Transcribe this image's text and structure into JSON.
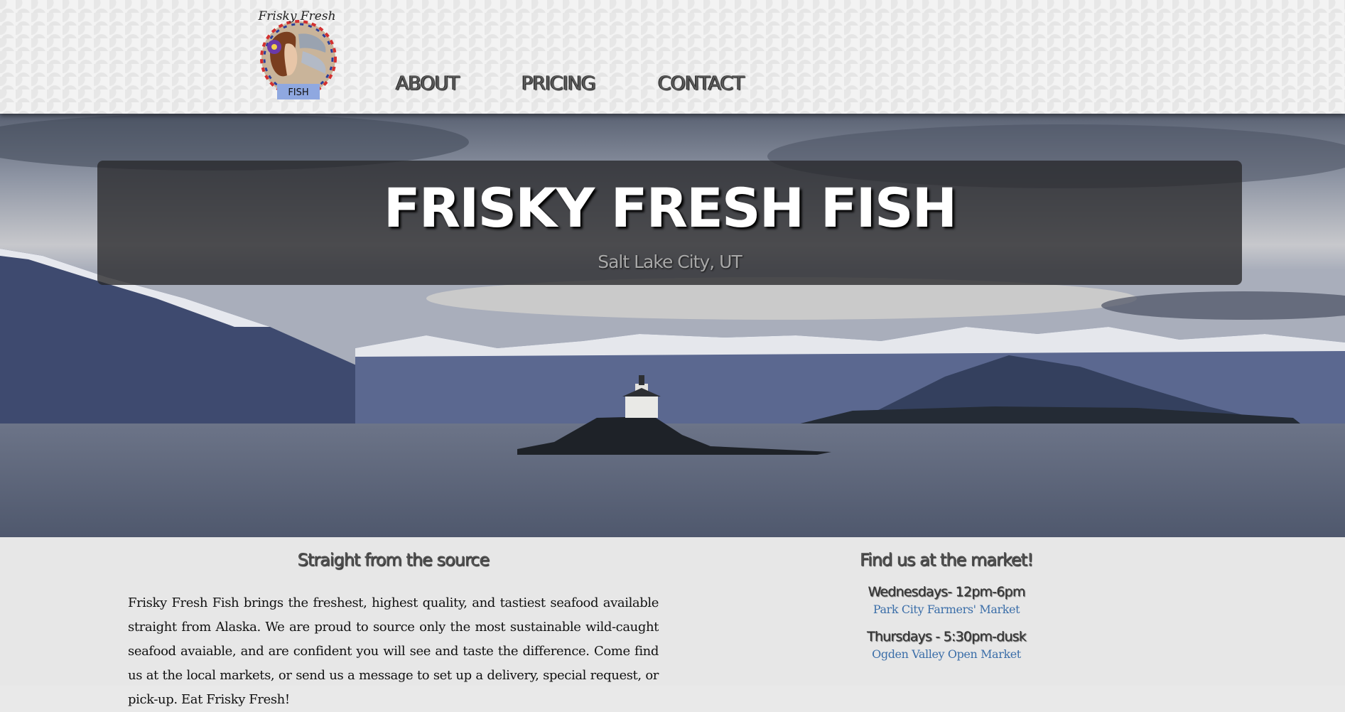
{
  "header": {
    "logo": {
      "text_top": "Frisky Fresh",
      "text_bottom": "FISH"
    },
    "nav": [
      {
        "label": "ABOUT"
      },
      {
        "label": "PRICING"
      },
      {
        "label": "CONTACT"
      }
    ]
  },
  "hero": {
    "title": "FRISKY FRESH FISH",
    "subtitle": "Salt Lake City, UT"
  },
  "about": {
    "heading": "Straight from the source",
    "body": "Frisky Fresh Fish brings the freshest, highest quality, and tastiest seafood available straight from Alaska. We are proud to source only the most sustainable wild-caught seafood avaiable, and are confident you will see and taste the difference. Come find us at the local markets, or send us a message to set up a delivery, special request, or pick-up. Eat Frisky Fresh!"
  },
  "markets": {
    "heading": "Find us at the market!",
    "items": [
      {
        "time": "Wednesdays- 12pm-6pm",
        "name": "Park City Farmers' Market"
      },
      {
        "time": "Thursdays - 5:30pm-dusk",
        "name": "Ogden Valley Open Market"
      }
    ]
  },
  "colors": {
    "link": "#3b6ea8",
    "header_bg": "#f3f3f3",
    "title_box": "#28282a"
  }
}
